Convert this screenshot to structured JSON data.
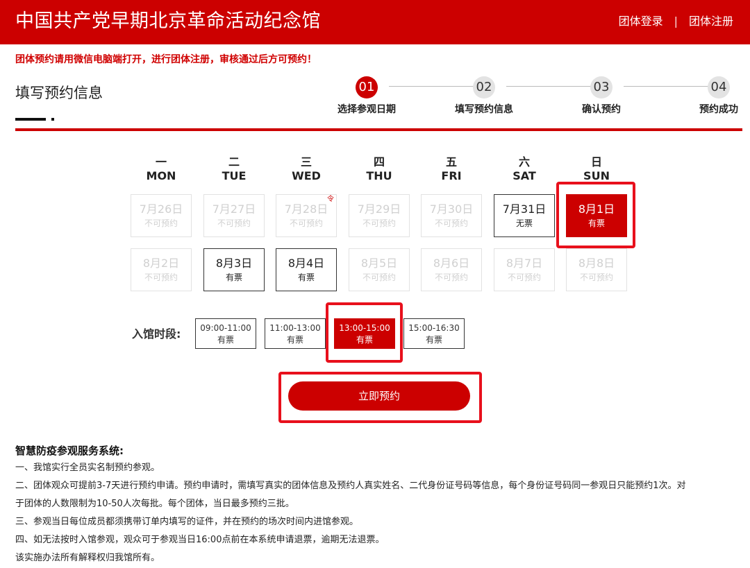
{
  "header": {
    "title": "中国共产党早期北京革命活动纪念馆",
    "login": "团体登录",
    "separator": "|",
    "register": "团体注册"
  },
  "notice": "团体预约请用微信电脑端打开，进行团体注册，审核通过后方可预约！",
  "section_title": "填写预约信息",
  "steps": [
    {
      "num": "01",
      "label": "选择参观日期",
      "active": true
    },
    {
      "num": "02",
      "label": "填写预约信息",
      "active": false
    },
    {
      "num": "03",
      "label": "确认预约",
      "active": false
    },
    {
      "num": "04",
      "label": "预约成功",
      "active": false
    }
  ],
  "weekdays": [
    {
      "cn": "一",
      "en": "MON"
    },
    {
      "cn": "二",
      "en": "TUE"
    },
    {
      "cn": "三",
      "en": "WED"
    },
    {
      "cn": "四",
      "en": "THU"
    },
    {
      "cn": "五",
      "en": "FRI"
    },
    {
      "cn": "六",
      "en": "SAT"
    },
    {
      "cn": "日",
      "en": "SUN"
    }
  ],
  "calendar": {
    "row1": [
      {
        "date": "7月26日",
        "status": "不可预约"
      },
      {
        "date": "7月27日",
        "status": "不可预约"
      },
      {
        "date": "7月28日",
        "status": "不可预约",
        "mark": "令"
      },
      {
        "date": "7月29日",
        "status": "不可预约"
      },
      {
        "date": "7月30日",
        "status": "不可预约"
      },
      {
        "date": "7月31日",
        "status": "无票"
      },
      {
        "date": "8月1日",
        "status": "有票"
      }
    ],
    "row2": [
      {
        "date": "8月2日",
        "status": "不可预约"
      },
      {
        "date": "8月3日",
        "status": "有票"
      },
      {
        "date": "8月4日",
        "status": "有票"
      },
      {
        "date": "8月5日",
        "status": "不可预约"
      },
      {
        "date": "8月6日",
        "status": "不可预约"
      },
      {
        "date": "8月7日",
        "status": "不可预约"
      },
      {
        "date": "8月8日",
        "status": "不可预约"
      }
    ]
  },
  "time_label": "入馆时段:",
  "slots": [
    {
      "time": "09:00-11:00",
      "status": "有票"
    },
    {
      "time": "11:00-13:00",
      "status": "有票"
    },
    {
      "time": "13:00-15:00",
      "status": "有票"
    },
    {
      "time": "15:00-16:30",
      "status": "有票"
    }
  ],
  "book_button": "立即预约",
  "info": {
    "title": "智慧防疫参观服务系统:",
    "lines": [
      "一、我馆实行全员实名制预约参观。",
      "二、团体观众可提前3-7天进行预约申请。预约申请时，需填写真实的团体信息及预约人真实姓名、二代身份证号码等信息，每个身份证号码同一参观日只能预约1次。对",
      "于团体的人数限制为10-50人次每批。每个团体，当日最多预约三批。",
      "三、参观当日每位成员都须携带订单内填写的证件，并在预约的场次时间内进馆参观。",
      "四、如无法按时入馆参观，观众可于参观当日16:00点前在本系统申请退票，逾期无法退票。",
      "该实施办法所有解释权归我馆所有。"
    ]
  },
  "colors": {
    "brand": "#cc0000",
    "highlight": "#e8101c"
  }
}
